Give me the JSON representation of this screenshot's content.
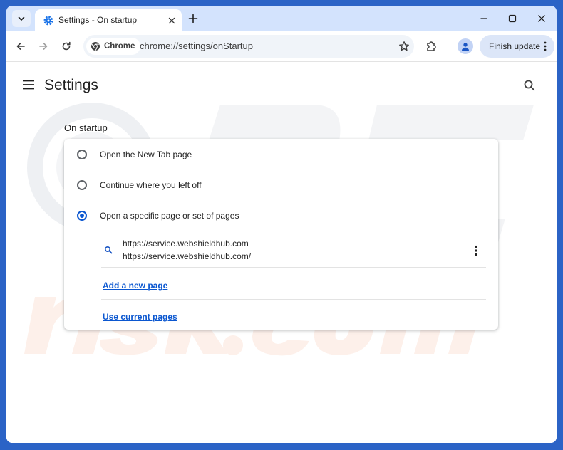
{
  "tab": {
    "title": "Settings - On startup"
  },
  "toolbar": {
    "chip_label": "Chrome",
    "url": "chrome://settings/onStartup",
    "finish_update_label": "Finish update"
  },
  "header": {
    "title": "Settings"
  },
  "startup": {
    "section_title": "On startup",
    "options": [
      {
        "label": "Open the New Tab page",
        "selected": false
      },
      {
        "label": "Continue where you left off",
        "selected": false
      },
      {
        "label": "Open a specific page or set of pages",
        "selected": true
      }
    ],
    "pages": [
      {
        "title": "https://service.webshieldhub.com",
        "url": "https://service.webshieldhub.com/"
      }
    ],
    "add_new_page_label": "Add a new page",
    "use_current_pages_label": "Use current pages"
  },
  "colors": {
    "accent": "#0b57d0",
    "tabstrip": "#d3e3fd",
    "frame": "#2b63c6"
  }
}
